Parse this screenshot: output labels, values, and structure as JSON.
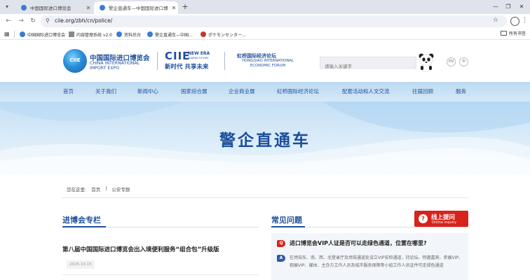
{
  "browser": {
    "tabs": [
      {
        "label": "中国国际进口博览会",
        "active": false
      },
      {
        "label": "警企直通车—中国国际进口博",
        "active": true
      }
    ],
    "url": "ciie.org/zbh/cn/police/",
    "bookmarks": [
      "中国国际进口博览会",
      "内容管理系统 v2.0",
      "资料后台",
      "警企直通车—中国...",
      "ポケモンセンター..."
    ],
    "all_bookmarks_label": "所有书签"
  },
  "header": {
    "logo_badge": "CIIE",
    "logo_cn": "中国国际进口博览会",
    "logo_en_line1": "CHINA INTERNATIONAL",
    "logo_en_line2": "IMPORT EXPO",
    "ciie_mark": "CIIE",
    "newera_line1": "NEW ERA",
    "newera_line2": "SHARED FUTURE",
    "slogan_cn": "新时代 共享未来",
    "forum_cn": "虹桥国际经济论坛",
    "forum_en_line1": "HONGQIAO INTERNATIONAL",
    "forum_en_line2": "ECONOMIC FORUM",
    "search_placeholder": "请输入关键字",
    "lang_en": "EN",
    "lang_cn": "中"
  },
  "nav": {
    "items": [
      "首页",
      "关于我们",
      "新闻中心",
      "国家综合展",
      "企业商业展",
      "虹桥国际经济论坛",
      "配套活动和人文交流",
      "往届回顾",
      "服务"
    ]
  },
  "banner": {
    "title": "警企直通车"
  },
  "breadcrumb": {
    "prefix": "您在这里:",
    "items": [
      "首页",
      "公安专题"
    ]
  },
  "left_section": {
    "title": "进博会专栏",
    "article_title": "第八届中国国际进口博览会出入境便利服务“组合包”升级版",
    "article_date": "2025.10.15"
  },
  "right_section": {
    "title": "常见问题",
    "inquiry_cn": "线上提问",
    "inquiry_en": "Online inquiry",
    "q_badge": "Q",
    "question": "进口博览会VIP人证是否可以走绿色通道，位置在哪里?",
    "a_badge": "A",
    "answer": "在场馆东、南、西、北登录厅及场馆通道处设立VIP安检通道，持论坛、特邀嘉宾、参展VIP、观展VIP、媒体、主办方工作人员及城市服务保障等小组工作人员证件可走绿色通道"
  },
  "colors": {
    "brand_blue": "#1f4f9d",
    "accent_red": "#d7231c",
    "nav_bg": "#c9e2f6"
  }
}
